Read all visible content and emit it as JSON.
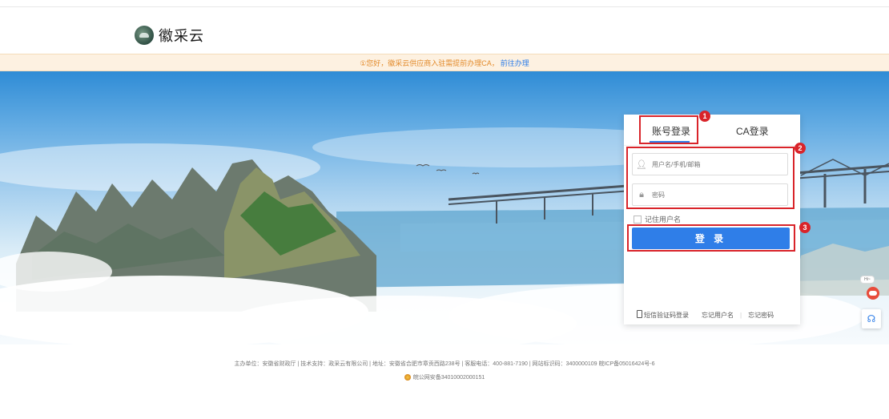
{
  "header": {
    "logo_text": "徽采云"
  },
  "notice": {
    "text": "①您好，徽采云供应商入驻需提前办理CA，",
    "link": "前往办理"
  },
  "login": {
    "tab_account": "账号登录",
    "tab_ca": "CA登录",
    "username_placeholder": "用户名/手机/邮箱",
    "password_placeholder": "密码",
    "remember_label": "记住用户名",
    "login_button": "登 录",
    "sms_login": "短信验证码登录",
    "forgot_username": "忘记用户名",
    "forgot_password": "忘记密码"
  },
  "annotations": {
    "n1": "1",
    "n2": "2",
    "n3": "3",
    "color": "#d9242a"
  },
  "side": {
    "bubble": "Hi~"
  },
  "footer": {
    "line1": "主办单位：安徽省财政厅 | 技术支持：政采云有限公司 | 地址：安徽省合肥市章贡西路238号 | 客服电话：400-881-7190 | 网站标识码：3400000109 皖ICP备05016424号-6",
    "line2": "皖公网安备34010002000151"
  },
  "colors": {
    "accent": "#2f7ee8",
    "notice_bg": "#fdf1e1",
    "notice_text": "#e38b2c"
  }
}
